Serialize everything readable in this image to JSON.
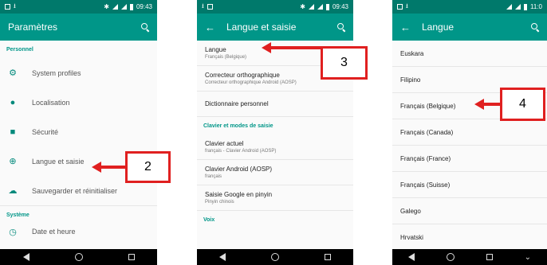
{
  "status": {
    "time1": "09:43",
    "time2": "09:43",
    "time3": "11:0"
  },
  "screen1": {
    "title": "Paramètres",
    "section_personal": "Personnel",
    "items": [
      {
        "label": "System profiles",
        "icon": "profiles-icon"
      },
      {
        "label": "Localisation",
        "icon": "location-icon"
      },
      {
        "label": "Sécurité",
        "icon": "lock-icon"
      },
      {
        "label": "Langue et saisie",
        "icon": "globe-icon"
      },
      {
        "label": "Sauvegarder et réinitialiser",
        "icon": "cloud-upload-icon"
      }
    ],
    "section_system": "Système",
    "partial_item": "Date et heure",
    "callout": "2"
  },
  "screen2": {
    "title": "Langue et saisie",
    "rows": [
      {
        "title": "Langue",
        "subtitle": "Français (Belgique)"
      },
      {
        "title": "Correcteur orthographique",
        "subtitle": "Correcteur orthographique Android (AOSP)"
      },
      {
        "title": "Dictionnaire personnel",
        "subtitle": ""
      }
    ],
    "section_keyboard": "Clavier et modes de saisie",
    "rows2": [
      {
        "title": "Clavier actuel",
        "subtitle": "français - Clavier Android (AOSP)"
      },
      {
        "title": "Clavier Android (AOSP)",
        "subtitle": "français"
      },
      {
        "title": "Saisie Google en pinyin",
        "subtitle": "Pinyin chinois"
      }
    ],
    "section_voice": "Voix",
    "callout": "3"
  },
  "screen3": {
    "title": "Langue",
    "languages": [
      "Euskara",
      "Filipino",
      "Français (Belgique)",
      "Français (Canada)",
      "Français (France)",
      "Français (Suisse)",
      "Galego",
      "Hrvatski"
    ],
    "callout": "4"
  },
  "colors": {
    "statusbar": "#00796b",
    "appbar": "#009688",
    "accent": "#009688",
    "callout_red": "#e02020"
  }
}
